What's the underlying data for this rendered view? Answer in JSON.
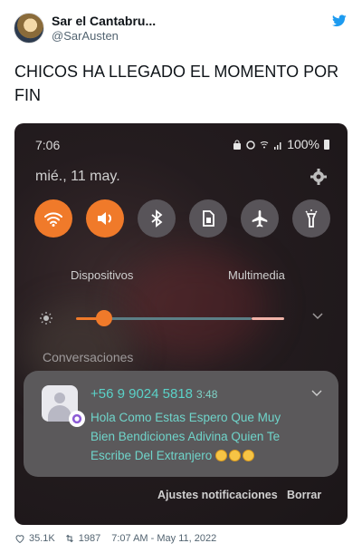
{
  "tweet": {
    "display_name": "Sar el Cantabru...",
    "handle": "@SarAusten",
    "text": "CHICOS HA LLEGADO EL MOMENTO POR FIN",
    "likes": "35.1K",
    "retweets": "1987",
    "timestamp": "7:07 AM - May 11, 2022",
    "brand_color": "#1d9bf0"
  },
  "phone": {
    "status": {
      "time": "7:06",
      "battery": "100%"
    },
    "date": "mié., 11 may.",
    "tiles": [
      {
        "name": "wifi-icon",
        "state": "on"
      },
      {
        "name": "volume-icon",
        "state": "on"
      },
      {
        "name": "bluetooth-icon",
        "state": "off"
      },
      {
        "name": "sim-icon",
        "state": "off"
      },
      {
        "name": "airplane-icon",
        "state": "off"
      },
      {
        "name": "flashlight-icon",
        "state": "off"
      }
    ],
    "labels": {
      "devices": "Dispositivos",
      "media": "Multimedia"
    },
    "brightness": 0.1,
    "section_title": "Conversaciones",
    "notification": {
      "sender": "+56 9 9024 5818",
      "time": "3:48",
      "message": "Hola Como Estas  Espero Que Muy Bien Bendiciones Adivina  Quien Te Escribe  Del Extranjero",
      "emojis": [
        "face-icon",
        "face-icon",
        "face-icon"
      ]
    },
    "actions": {
      "settings": "Ajustes notificaciones",
      "clear": "Borrar"
    },
    "accent_color": "#f07a2a",
    "message_color": "#5ad2c8"
  }
}
